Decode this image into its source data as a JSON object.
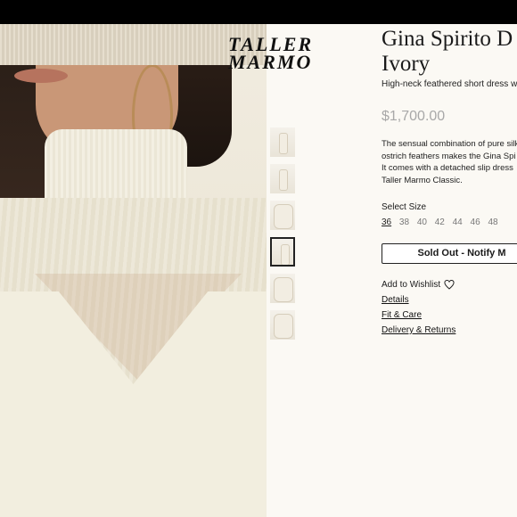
{
  "brand": {
    "logo_text": "TALLER MARMO"
  },
  "product": {
    "title_line1": "Gina Spirito D",
    "title_line2": "Ivory",
    "subtitle": "High-neck feathered short dress wit",
    "price": "$1,700.00",
    "description": [
      "The sensual combination of pure silk",
      "ostrich feathers makes the Gina Spi",
      "It comes with a detached slip dress",
      "Taller Marmo Classic."
    ]
  },
  "size_selector": {
    "label": "Select Size",
    "sizes": [
      "36",
      "38",
      "40",
      "42",
      "44",
      "46",
      "48"
    ],
    "selected": "36"
  },
  "actions": {
    "sold_out_button": "Sold Out - Notify M",
    "wishlist": "Add to Wishlist"
  },
  "links": {
    "details": "Details",
    "fit_care": "Fit & Care",
    "delivery": "Delivery & Returns"
  },
  "colors": {
    "background": "#fbf9f4",
    "price": "#a8a8a8",
    "topbar": "#000000"
  }
}
